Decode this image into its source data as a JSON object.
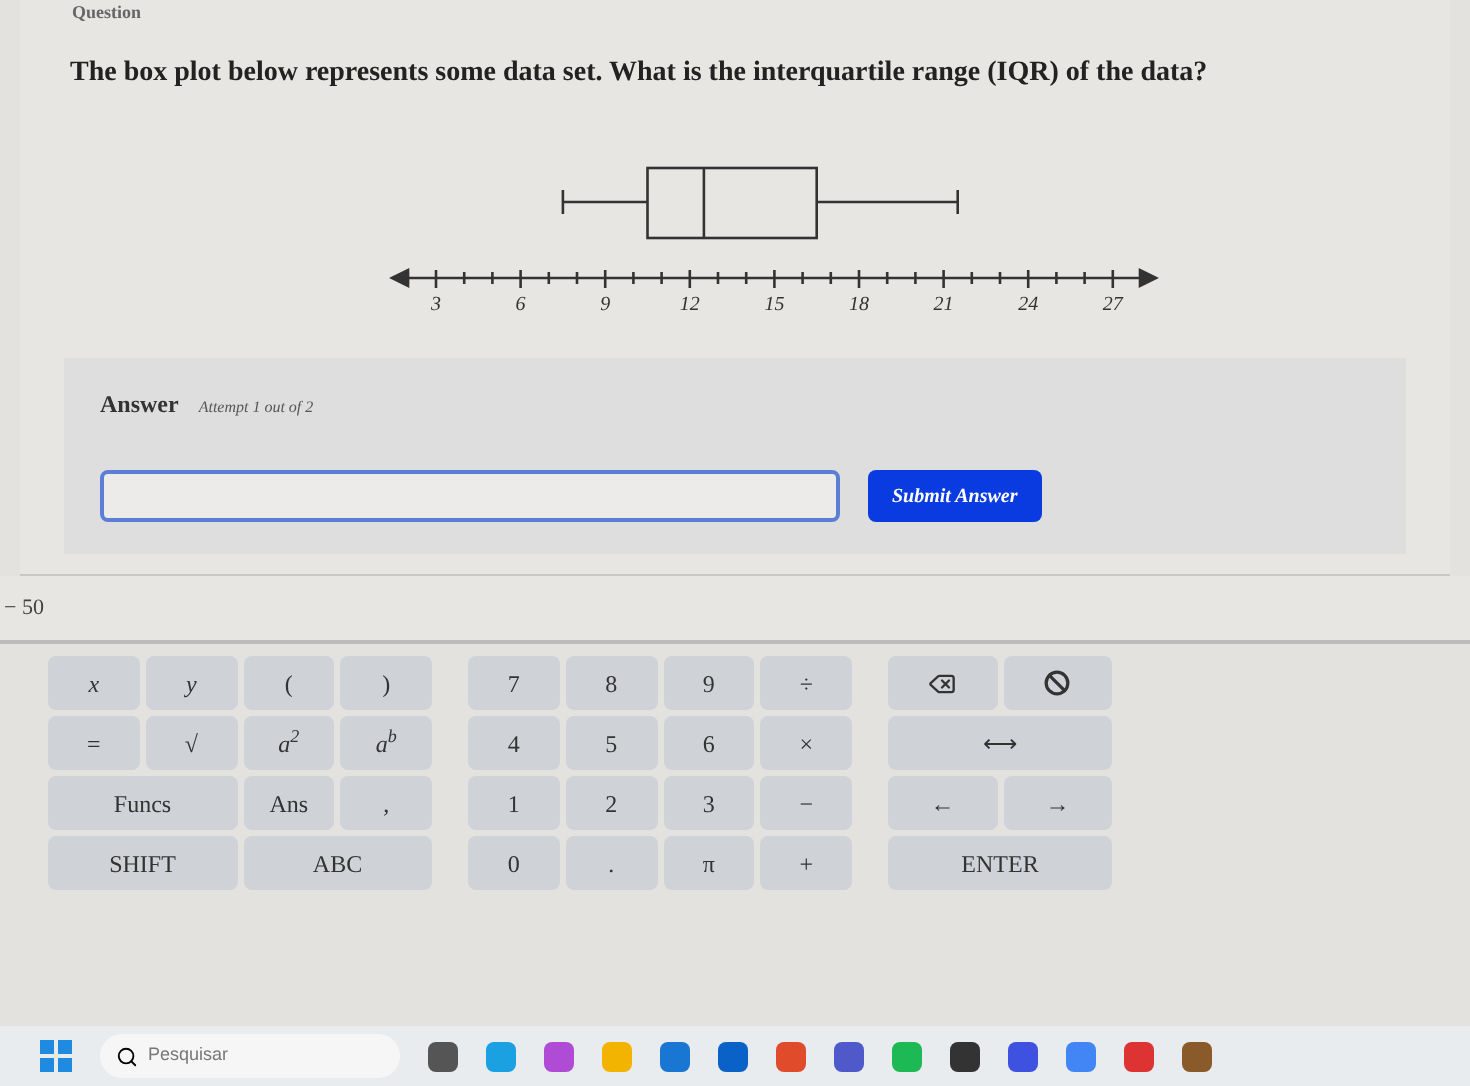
{
  "header": {
    "title": "Question"
  },
  "question": {
    "text": "The box plot below represents some data set. What is the interquartile range (IQR) of the data?"
  },
  "number_line": {
    "labels": [
      "3",
      "6",
      "9",
      "12",
      "15",
      "18",
      "21",
      "24",
      "27"
    ]
  },
  "answer": {
    "label": "Answer",
    "attempt": "Attempt 1 out of 2",
    "button": "Submit Answer"
  },
  "range_text": "− 50",
  "keypad": [
    [
      {
        "label": "x",
        "italic": true
      },
      {
        "label": "y",
        "italic": true
      },
      {
        "label": "("
      },
      {
        "label": ")"
      }
    ],
    [
      {
        "label": "="
      },
      {
        "label": "√"
      },
      {
        "label": "a$^{2}$",
        "italic": true
      },
      {
        "label": "a$^{b}$",
        "italic": true
      }
    ],
    [
      {
        "label": "Funcs",
        "wide": true
      },
      {
        "label": "Ans"
      },
      {
        "label": ","
      }
    ],
    [
      {
        "label": "SHIFT",
        "wide": true
      },
      {
        "label": "ABC",
        "wide": true
      }
    ]
  ],
  "numpad": [
    [
      {
        "label": "7"
      },
      {
        "label": "8"
      },
      {
        "label": "9"
      },
      {
        "label": "÷"
      }
    ],
    [
      {
        "label": "4"
      },
      {
        "label": "5"
      },
      {
        "label": "6"
      },
      {
        "label": "×"
      }
    ],
    [
      {
        "label": "1"
      },
      {
        "label": "2"
      },
      {
        "label": "3"
      },
      {
        "label": "−"
      }
    ],
    [
      {
        "label": "0"
      },
      {
        "label": "."
      },
      {
        "label": "π"
      },
      {
        "label": "+"
      }
    ]
  ],
  "controls": [
    [
      {
        "kind": "backspace"
      },
      {
        "kind": "clear"
      }
    ],
    [
      {
        "kind": "text",
        "label": "⟷",
        "wide": true
      }
    ],
    [
      {
        "kind": "text",
        "label": "←"
      },
      {
        "kind": "text",
        "label": "→"
      }
    ],
    [
      {
        "kind": "text",
        "label": "ENTER",
        "wide": true
      }
    ]
  ],
  "taskbar": {
    "search_placeholder": "Pesquisar"
  }
}
